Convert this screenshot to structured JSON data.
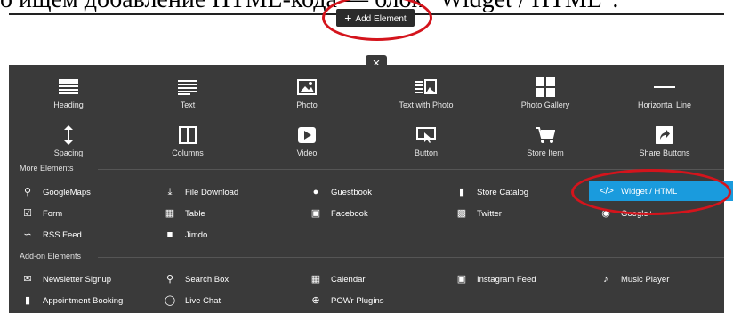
{
  "top_text": "о ищем добавление HTML-кода — блок \"Widget / HTML\".",
  "add_element": "Add Element",
  "close_label": "×",
  "tiles_row1": [
    {
      "label": "Heading",
      "icon": "heading-icon"
    },
    {
      "label": "Text",
      "icon": "text-icon"
    },
    {
      "label": "Photo",
      "icon": "photo-icon"
    },
    {
      "label": "Text with Photo",
      "icon": "text-with-photo-icon"
    },
    {
      "label": "Photo Gallery",
      "icon": "photo-gallery-icon"
    },
    {
      "label": "Horizontal Line",
      "icon": "horizontal-line-icon"
    }
  ],
  "tiles_row2": [
    {
      "label": "Spacing",
      "icon": "spacing-icon"
    },
    {
      "label": "Columns",
      "icon": "columns-icon"
    },
    {
      "label": "Video",
      "icon": "video-icon"
    },
    {
      "label": "Button",
      "icon": "button-icon"
    },
    {
      "label": "Store Item",
      "icon": "store-item-icon"
    },
    {
      "label": "Share Buttons",
      "icon": "share-buttons-icon"
    }
  ],
  "more_elements": {
    "title": "More Elements",
    "items": [
      {
        "label": "GoogleMaps",
        "icon": "map-pin-icon"
      },
      {
        "label": "File Download",
        "icon": "download-icon"
      },
      {
        "label": "Guestbook",
        "icon": "speech-bubble-icon"
      },
      {
        "label": "Store Catalog",
        "icon": "catalog-icon"
      },
      {
        "label": "Widget / HTML",
        "icon": "code-icon"
      },
      {
        "label": "Form",
        "icon": "checkbox-icon"
      },
      {
        "label": "Table",
        "icon": "table-icon"
      },
      {
        "label": "Facebook",
        "icon": "facebook-icon"
      },
      {
        "label": "Twitter",
        "icon": "twitter-icon"
      },
      {
        "label": "Google+",
        "icon": "google-plus-icon"
      },
      {
        "label": "RSS Feed",
        "icon": "rss-icon"
      },
      {
        "label": "Jimdo",
        "icon": "jimdo-icon"
      }
    ]
  },
  "addon_elements": {
    "title": "Add-on Elements",
    "items": [
      {
        "label": "Newsletter Signup",
        "icon": "envelope-icon"
      },
      {
        "label": "Search Box",
        "icon": "search-icon"
      },
      {
        "label": "Calendar",
        "icon": "calendar-icon"
      },
      {
        "label": "Instagram Feed",
        "icon": "instagram-icon"
      },
      {
        "label": "Music Player",
        "icon": "speaker-icon"
      },
      {
        "label": "Appointment Booking",
        "icon": "booking-icon"
      },
      {
        "label": "Live Chat",
        "icon": "chat-icon"
      },
      {
        "label": "POWr Plugins",
        "icon": "plus-circle-icon"
      }
    ]
  },
  "colors": {
    "panel": "#3a3a3a",
    "accent": "#1a9bdd",
    "highlight": "#d4141c"
  }
}
